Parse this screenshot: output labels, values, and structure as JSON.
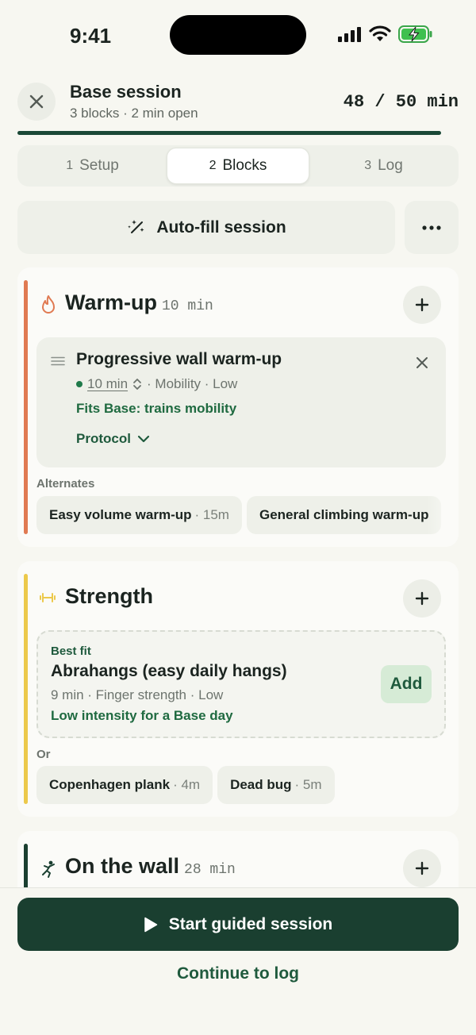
{
  "status_bar": {
    "time": "9:41"
  },
  "header": {
    "title": "Base session",
    "subtitle": "3 blocks · 2 min open",
    "time_used": "48 / 50 min",
    "progress": 0.96
  },
  "tabs": [
    {
      "num": "1",
      "label": "Setup",
      "active": false
    },
    {
      "num": "2",
      "label": "Blocks",
      "active": true
    },
    {
      "num": "3",
      "label": "Log",
      "active": false
    }
  ],
  "autofill": {
    "label": "Auto-fill session"
  },
  "sections": {
    "warmup": {
      "title": "Warm-up",
      "duration": "10 min",
      "accent": "#e07a52",
      "item": {
        "title": "Progressive wall warm-up",
        "duration": "10 min",
        "meta": "· Mobility · Low",
        "fit": "Fits Base: trains mobility",
        "protocol": "Protocol"
      },
      "alternates_label": "Alternates",
      "alternates": [
        {
          "name": "Easy volume warm-up",
          "meta": "· 15m"
        },
        {
          "name": "General climbing warm-up",
          "meta": ""
        }
      ]
    },
    "strength": {
      "title": "Strength",
      "accent": "#ecc94b",
      "best": {
        "label": "Best fit",
        "title": "Abrahangs (easy daily hangs)",
        "meta": "9 min · Finger strength · Low",
        "fit": "Low intensity for a Base day",
        "add_label": "Add"
      },
      "or_label": "Or",
      "options": [
        {
          "name": "Copenhagen plank",
          "meta": "· 4m"
        },
        {
          "name": "Dead bug",
          "meta": "· 5m"
        }
      ]
    },
    "wall": {
      "title": "On the wall",
      "duration": "28 min",
      "accent": "#1a3f30"
    }
  },
  "actions": {
    "start": "Start guided session",
    "continue": "Continue to log"
  },
  "colors": {
    "primary": "#1a3f30",
    "accent_green": "#1f6a40",
    "background": "#f7f7f1"
  }
}
